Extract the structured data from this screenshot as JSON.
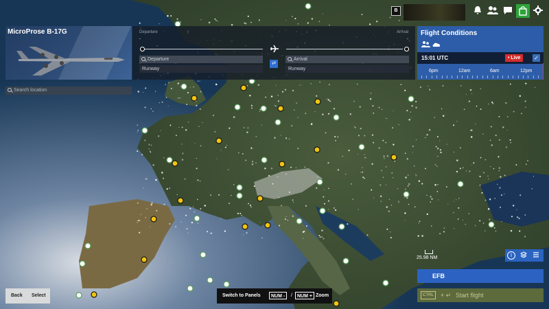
{
  "aircraft": {
    "name": "MicroProse B-17G"
  },
  "route": {
    "departure_header": "Departure",
    "arrival_header": "Arrival",
    "departure_placeholder": "Departure",
    "arrival_placeholder": "Arrival",
    "departure_runway": "Runway",
    "arrival_runway": "Runway",
    "departure_marker": "-",
    "arrival_marker": "-"
  },
  "flight_conditions": {
    "title": "Flight Conditions",
    "time": "15:01 UTC",
    "live_label": "Live",
    "timeline_hours": [
      "6pm",
      "12am",
      "6am",
      "12pm"
    ]
  },
  "search": {
    "placeholder": "Search location"
  },
  "map": {
    "scale_label": "25.98 NM"
  },
  "bottom": {
    "back_label": "Back",
    "select_label": "Select",
    "switch_panels_label": "Switch to Panels",
    "zoom_out_key": "NUM -",
    "separator": "/",
    "zoom_in_key": "NUM +",
    "zoom_label": "Zoom",
    "efb_label": "EFB",
    "start_flight_label": "Start flight",
    "ctrl_key": "CTRL"
  },
  "topbar": {
    "b_label": "B",
    "icons": [
      "bell-icon",
      "friends-icon",
      "chat-icon",
      "marketplace-icon",
      "settings-icon"
    ]
  },
  "colors": {
    "accent": "#2c63c2",
    "live": "#d42d2d",
    "airport_marker": "#f2c40f"
  }
}
